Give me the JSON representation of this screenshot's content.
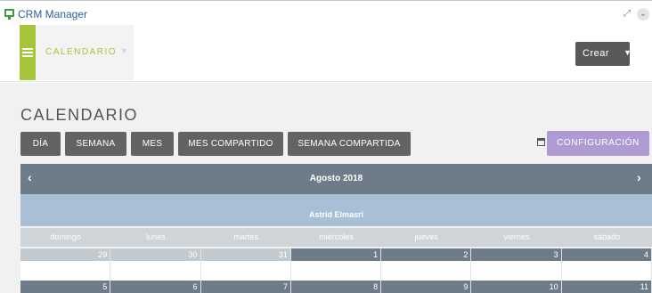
{
  "window": {
    "title": "CRM Manager",
    "expand_icon": "expand-icon",
    "menu_icon": "chevron-down-icon"
  },
  "nav": {
    "module_label": "CALENDARIO",
    "crear_label": "Crear"
  },
  "page": {
    "title": "CALENDARIO"
  },
  "views": [
    "DÍA",
    "SEMANA",
    "MES",
    "MES COMPARTIDO",
    "SEMANA COMPARTIDA"
  ],
  "config_label": "CONFIGURACIÓN",
  "calendar": {
    "month": "Agosto 2018",
    "user": "Astrid Elmasri",
    "days_of_week": [
      "domingo",
      "lunes",
      "martes",
      "miércoles",
      "jueves",
      "viernes",
      "sábado"
    ],
    "weeks": [
      {
        "days": [
          {
            "n": "29",
            "other_month": true
          },
          {
            "n": "30",
            "other_month": true
          },
          {
            "n": "31",
            "other_month": true
          },
          {
            "n": "1",
            "other_month": false
          },
          {
            "n": "2",
            "other_month": false
          },
          {
            "n": "3",
            "other_month": false
          },
          {
            "n": "4",
            "other_month": false
          }
        ]
      },
      {
        "days": [
          {
            "n": "5",
            "other_month": false
          },
          {
            "n": "6",
            "other_month": false
          },
          {
            "n": "7",
            "other_month": false
          },
          {
            "n": "8",
            "other_month": false
          },
          {
            "n": "9",
            "other_month": false
          },
          {
            "n": "10",
            "other_month": false
          },
          {
            "n": "11",
            "other_month": false
          }
        ]
      }
    ]
  },
  "colors": {
    "accent_green": "#a6c53a",
    "config_purple": "#b09ad3",
    "header_slate": "#6e7c8a",
    "user_row_blue": "#a9bfd5",
    "other_month": "#c2c9cf",
    "current_month": "#6e7c8a"
  }
}
